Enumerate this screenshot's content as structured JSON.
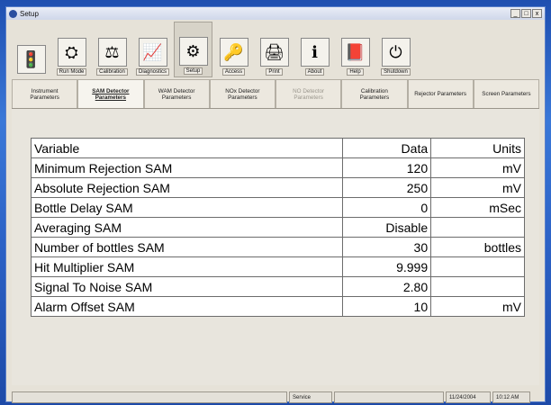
{
  "window": {
    "title": "Setup",
    "buttons": {
      "minimize": "_",
      "maximize": "□",
      "close": "x"
    }
  },
  "toolbar": [
    {
      "name": "traffic-light",
      "label": "",
      "icon": "traffic-light-icon",
      "glyph": "🚦"
    },
    {
      "name": "run-mode",
      "label": "Run Mode",
      "icon": "run-mode-icon",
      "glyph": "⛭"
    },
    {
      "name": "calibration",
      "label": "Calibration",
      "icon": "calibration-icon",
      "glyph": "⚖"
    },
    {
      "name": "diagnostics",
      "label": "Diagnostics",
      "icon": "diagnostics-icon",
      "glyph": "📈"
    },
    {
      "name": "setup",
      "label": "Setup",
      "icon": "setup-icon",
      "glyph": "⚙"
    },
    {
      "name": "access",
      "label": "Access",
      "icon": "key-icon",
      "glyph": "🔑"
    },
    {
      "name": "print",
      "label": "Print",
      "icon": "printer-icon",
      "glyph": "🖨"
    },
    {
      "name": "about",
      "label": "About",
      "icon": "about-icon",
      "glyph": "ℹ"
    },
    {
      "name": "help",
      "label": "Help",
      "icon": "help-book-icon",
      "glyph": "📕"
    },
    {
      "name": "shutdown",
      "label": "Shutdown",
      "icon": "shutdown-icon",
      "glyph": "⏻"
    }
  ],
  "tabs": [
    {
      "label": "Instrument\nParameters",
      "state": "normal"
    },
    {
      "label": "SAM Detector\nParameters",
      "state": "active"
    },
    {
      "label": "WAM Detector\nParameters",
      "state": "normal"
    },
    {
      "label": "NOx Detector\nParameters",
      "state": "normal"
    },
    {
      "label": "NO Detector\nParameters",
      "state": "disabled"
    },
    {
      "label": "Calibration\nParameters",
      "state": "normal"
    },
    {
      "label": "Rejector Parameters",
      "state": "normal"
    },
    {
      "label": "Screen Parameters",
      "state": "normal"
    }
  ],
  "table": {
    "headers": [
      "Variable",
      "Data",
      "Units"
    ],
    "rows": [
      [
        "Minimum Rejection SAM",
        "120",
        "mV"
      ],
      [
        "Absolute Rejection SAM",
        "250",
        "mV"
      ],
      [
        "Bottle Delay SAM",
        "0",
        "mSec"
      ],
      [
        "Averaging SAM",
        "Disable",
        ""
      ],
      [
        "Number of bottles SAM",
        "30",
        "bottles"
      ],
      [
        "Hit Multiplier SAM",
        "9.999",
        ""
      ],
      [
        "Signal To Noise SAM",
        "2.80",
        ""
      ],
      [
        "Alarm Offset SAM",
        "10",
        "mV"
      ]
    ]
  },
  "status": {
    "mode": "Service",
    "date": "11/24/2004",
    "time": "10:12 AM"
  }
}
